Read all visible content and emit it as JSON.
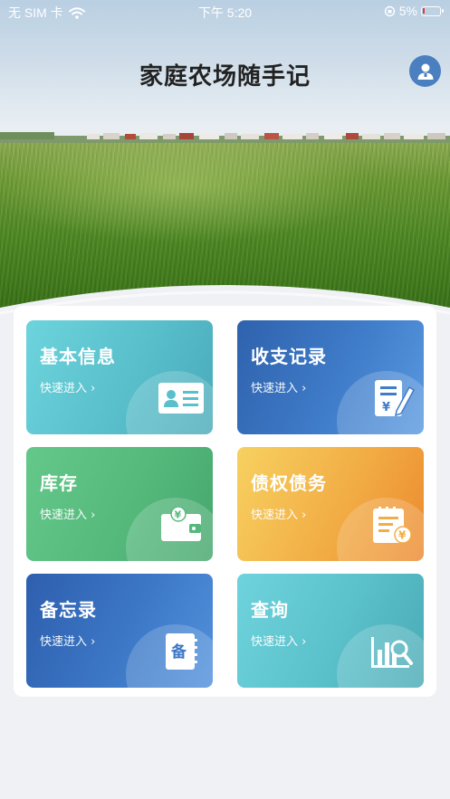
{
  "status_bar": {
    "carrier": "无 SIM 卡",
    "time": "下午 5:20",
    "battery": "5%"
  },
  "header": {
    "title": "家庭农场随手记",
    "avatar_icon": "user-avatar-icon"
  },
  "cards": [
    {
      "title": "基本信息",
      "subtitle": "快速进入 ›",
      "icon": "id-card-icon"
    },
    {
      "title": "收支记录",
      "subtitle": "快速进入 ›",
      "icon": "ledger-edit-icon"
    },
    {
      "title": "库存",
      "subtitle": "快速进入 ›",
      "icon": "wallet-icon"
    },
    {
      "title": "债权债务",
      "subtitle": "快速进入 ›",
      "icon": "debt-document-icon"
    },
    {
      "title": "备忘录",
      "subtitle": "快速进入 ›",
      "icon": "memo-book-icon"
    },
    {
      "title": "查询",
      "subtitle": "快速进入 ›",
      "icon": "chart-search-icon"
    }
  ],
  "memo_icon_char": "备",
  "currency_char": "¥",
  "colors": {
    "avatar": "#4a7fc0",
    "teal": "#58bfcb",
    "blue": "#3f7cc9",
    "green": "#55b97c",
    "orange": "#f2ad45"
  }
}
